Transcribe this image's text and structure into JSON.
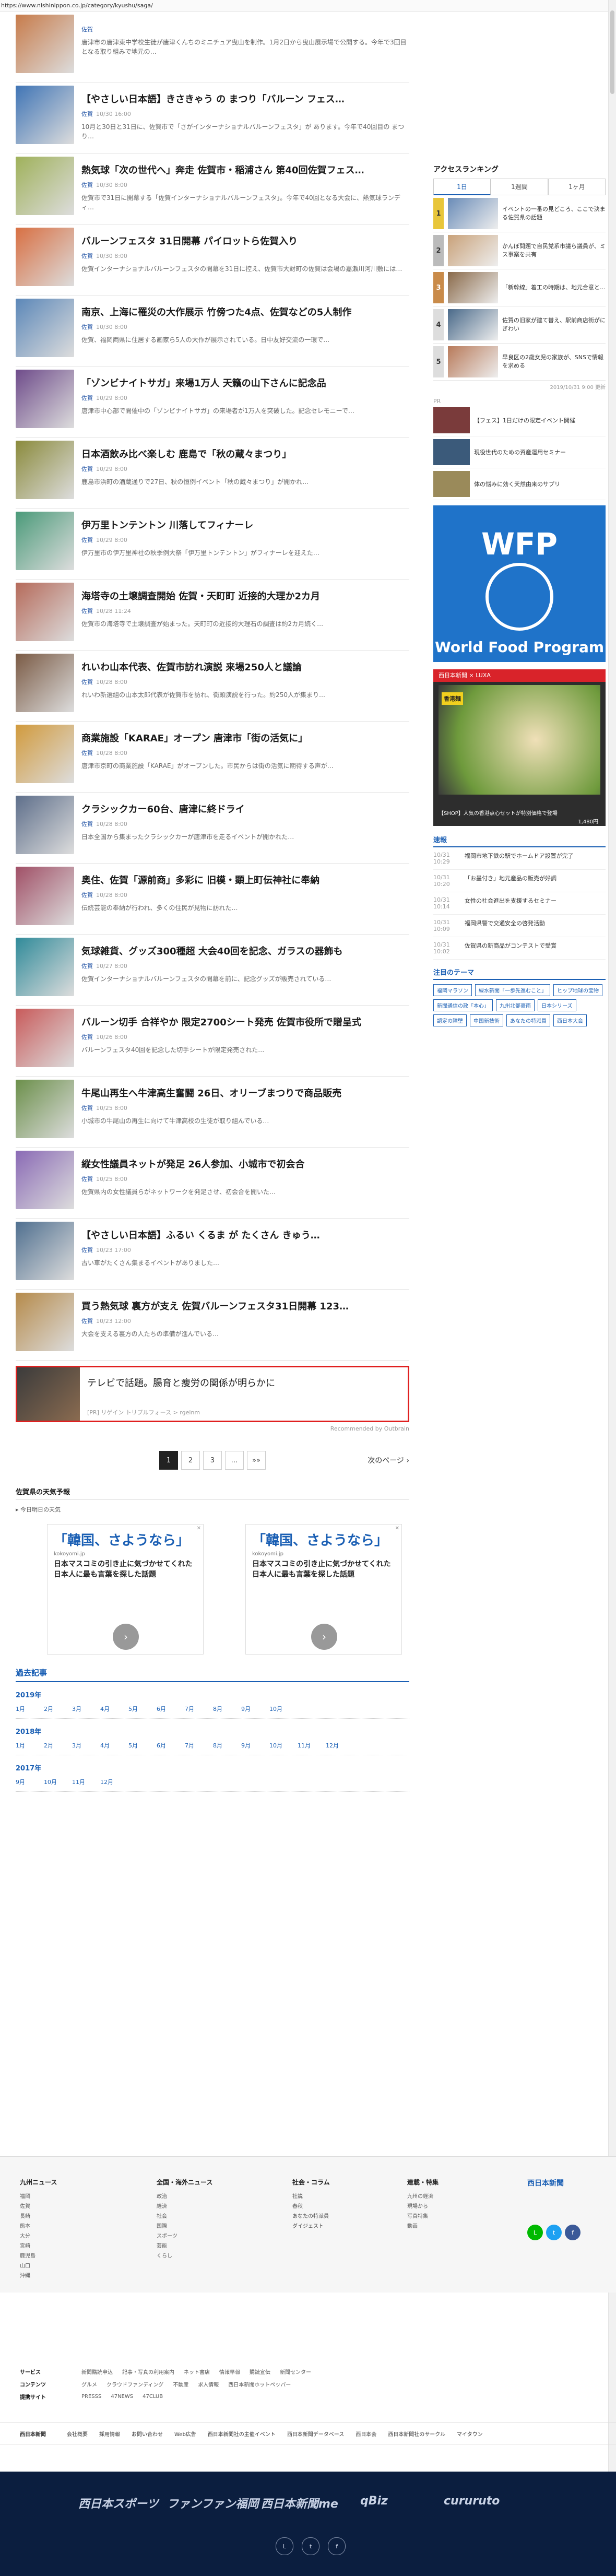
{
  "url": "https://www.nishinippon.co.jp/category/kyushu/saga/",
  "articles": [
    {
      "title": "",
      "tag": "佐賀",
      "time": "",
      "lead": "唐津市の唐津東中学校生徒が唐津くんちのミニチュア曳山を制作。1月2日から曳山展示場で公開する。今年で3回目となる取り組みで地元の…"
    },
    {
      "title": "【やさしい日本語】きさきゃう の まつり「バルーン フェス…",
      "tag": "佐賀",
      "time": "10/30 16:00",
      "lead": "10月と30日と31日に、佐賀市で「さがインターナショナルバルーンフェスタ」が あります。今年で40回目の まつり…"
    },
    {
      "title": "熱気球「次の世代へ」奔走 佐賀市・稲浦さん 第40回佐賀フェス…",
      "tag": "佐賀",
      "time": "10/30 8:00",
      "lead": "佐賀市で31日に開幕する「佐賀インターナショナルバルーンフェスタ」。今年で40回となる大会に、熱気球ランディ…"
    },
    {
      "title": "バルーンフェスタ 31日開幕 パイロットら佐賀入り",
      "tag": "佐賀",
      "time": "10/30 8:00",
      "lead": "佐賀インターナショナルバルーンフェスタの開幕を31日に控え、佐賀市大財町の佐賀は会場の嘉瀬川河川敷には…"
    },
    {
      "title": "南京、上海に罹災の大作展示 竹傍つた4点、佐賀などの5人制作",
      "tag": "佐賀",
      "time": "10/30 8:00",
      "lead": "佐賀、福岡両県に住居する画家ら5人の大作が展示されている。日中友好交流の一環で…"
    },
    {
      "title": "「ゾンビナイトサガ」来場1万人 天籟の山下さんに記念品",
      "tag": "佐賀",
      "time": "10/29 8:00",
      "lead": "唐津市中心部で開催中の「ゾンビナイトサガ」の来場者が1万人を突破した。記念セレモニーで…"
    },
    {
      "title": "日本酒飲み比べ楽しむ 鹿島で「秋の蔵々まつり」",
      "tag": "佐賀",
      "time": "10/29 8:00",
      "lead": "鹿島市浜町の酒蔵通りで27日、秋の恒例イベント「秋の蔵々まつり」が開かれ…"
    },
    {
      "title": "伊万里トンテントン 川落してフィナーレ",
      "tag": "佐賀",
      "time": "10/29 8:00",
      "lead": "伊万里市の伊万里神社の秋季例大祭「伊万里トンテントン」がフィナーレを迎えた…"
    },
    {
      "title": "海塔寺の土壌調査開始 佐賀・天町町 近接的大理か2カ月",
      "tag": "佐賀",
      "time": "10/28 11:24",
      "lead": "佐賀市の海塔寺で土壌調査が始まった。天町町の近接的大理石の調査は約2カ月続く…"
    },
    {
      "title": "れいわ山本代表、佐賀市訪れ演説 来場250人と議論",
      "tag": "佐賀",
      "time": "10/28 8:00",
      "lead": "れいわ新選組の山本太郎代表が佐賀市を訪れ、街頭演説を行った。約250人が集まり…"
    },
    {
      "title": "商業施設「KARAE」オープン 唐津市「街の活気に」",
      "tag": "佐賀",
      "time": "10/28 8:00",
      "lead": "唐津市京町の商業施設「KARAE」がオープンした。市民からは街の活気に期待する声が…"
    },
    {
      "title": "クラシックカー60台、唐津に終ドライ",
      "tag": "佐賀",
      "time": "10/28 8:00",
      "lead": "日本全国から集まったクラシックカーが唐津市を走るイベントが開かれた…"
    },
    {
      "title": "奥住、佐賀「源前商」多彩に 旧模・顕上町伝神社に奉納",
      "tag": "佐賀",
      "time": "10/28 8:00",
      "lead": "伝統芸能の奉納が行われ、多くの住民が見物に訪れた…"
    },
    {
      "title": "気球雑貨、グッズ300種超 大会40回を記念、ガラスの器飾も",
      "tag": "佐賀",
      "time": "10/27 8:00",
      "lead": "佐賀インターナショナルバルーンフェスタの開幕を前に、記念グッズが販売されている…"
    },
    {
      "title": "バルーン切手 合祥やか 限定2700シート発売 佐賀市役所で贈呈式",
      "tag": "佐賀",
      "time": "10/26 8:00",
      "lead": "バルーンフェスタ40回を記念した切手シートが限定発売された…"
    },
    {
      "title": "牛尾山再生へ牛津高生奮闘 26日、オリーブまつりで商品販売",
      "tag": "佐賀",
      "time": "10/25 8:00",
      "lead": "小城市の牛尾山の再生に向けて牛津高校の生徒が取り組んでいる…"
    },
    {
      "title": "縦女性議員ネットが発足 26人参加、小城市で初会合",
      "tag": "佐賀",
      "time": "10/25 8:00",
      "lead": "佐賀県内の女性議員らがネットワークを発足させ、初会合を開いた…"
    },
    {
      "title": "【やさしい日本語】ふるい くるま が たくさん きゅう…",
      "tag": "佐賀",
      "time": "10/23 17:00",
      "lead": "古い車がたくさん集まるイベントがありました…"
    },
    {
      "title": "買う熱気球 裏方が支え 佐賀バルーンフェスタ31日開幕 123…",
      "tag": "佐賀",
      "time": "10/23 12:00",
      "lead": "大会を支える裏方の人たちの準備が進んでいる…"
    }
  ],
  "promo": {
    "title": "テレビで話題。腸育と痩労の関係が明らかに",
    "meta": "[PR] リゲイン トリプルフォース > rgeinm"
  },
  "recommended": "Recommended by Outbrain",
  "pagination": {
    "pages": [
      "1",
      "2",
      "3",
      "…",
      "»»"
    ],
    "next": "次のページ"
  },
  "popular": {
    "title": "佐賀県の天気予報",
    "note": "今日明日の天気"
  },
  "ads": [
    {
      "title": "「韓国、さようなら」",
      "domain": "kokoyomi.jp",
      "text": "日本マスコミの引き止に気づかせてくれた日本人に最も言葉を探した話題"
    },
    {
      "title": "「韓国、さようなら」",
      "domain": "kokoyomi.jp",
      "text": "日本マスコミの引き止に気づかせてくれた日本人に最も言葉を探した話題"
    }
  ],
  "archive": {
    "title": "過去記事",
    "years": [
      {
        "year": "2019年",
        "months": [
          "1月",
          "2月",
          "3月",
          "4月",
          "5月",
          "6月",
          "7月",
          "8月",
          "9月",
          "10月"
        ]
      },
      {
        "year": "2018年",
        "months": [
          "1月",
          "2月",
          "3月",
          "4月",
          "5月",
          "6月",
          "7月",
          "8月",
          "9月",
          "10月",
          "11月",
          "12月"
        ]
      },
      {
        "year": "2017年",
        "months": [
          "9月",
          "10月",
          "11月",
          "12月"
        ]
      }
    ]
  },
  "sidebar": {
    "ranking_title": "アクセスランキング",
    "tabs": [
      "1日",
      "1週間",
      "1ヶ月"
    ],
    "ranks": [
      {
        "n": "1",
        "t": "イベントの一番の見どころ、ここで決まる佐賀県の話題"
      },
      {
        "n": "2",
        "t": "かんぽ問題で自民党系市議ら議員が、ミス事案を共有"
      },
      {
        "n": "3",
        "t": "「新幹線」着工の時期は、地元合意と…"
      },
      {
        "n": "4",
        "t": "佐賀の旧家が建て替え、駅前商店街がにぎわい"
      },
      {
        "n": "5",
        "t": "早良区の2歳女児の家族が、SNSで情報を求める"
      }
    ],
    "stamp": "2019/10/31 9:00 更新",
    "pr_title": "PR",
    "prs": [
      {
        "t": "【フェス】1日だけの限定イベント開催"
      },
      {
        "t": "現役世代のための資産運用セミナー"
      },
      {
        "t": "体の悩みに効く天然由来のサプリ"
      }
    ],
    "wfp_jp": "WFP",
    "wfp_name": "World Food Program",
    "luxa_top": "西日本新聞 × LUXA",
    "luxa_badge": "香港麺",
    "luxa_cap": "【SHOP】人気の香港点心セットが特別価格で登場",
    "luxa_price": "1,480円",
    "news_title": "速報",
    "news": [
      {
        "tm": "10/31 10:29",
        "t": "福岡市地下鉄の駅でホームドア設置が完了"
      },
      {
        "tm": "10/31 10:20",
        "t": "「お墨付き」地元産品の販売が好調"
      },
      {
        "tm": "10/31 10:14",
        "t": "女性の社会進出を支援するセミナー"
      },
      {
        "tm": "10/31 10:09",
        "t": "福岡県警で交通安全の啓発活動"
      },
      {
        "tm": "10/31 10:02",
        "t": "佐賀県の新商品がコンテストで受賞"
      }
    ],
    "theme_title": "注目のテーマ",
    "themes": [
      "福岡マラソン",
      "緑水新聞「一歩先進むこと」",
      "ヒップ地球の宝物",
      "新聞通信の政「本心」",
      "九州北部豪雨",
      "日本シリーズ",
      "認定の障壁",
      "中国新技術",
      "あなたの特派員",
      "西日本大会"
    ]
  },
  "footer": {
    "cols": [
      {
        "h": "九州ニュース",
        "items": [
          "福岡",
          "佐賀",
          "長崎",
          "熊本",
          "大分",
          "宮崎",
          "鹿児島",
          "山口",
          "沖縄"
        ]
      },
      {
        "h": "全国・海外ニュース",
        "items": [
          "政治",
          "経済",
          "社会",
          "国際",
          "スポーツ",
          "芸能",
          "くらし"
        ]
      },
      {
        "h": "社会・コラム",
        "items": [
          "社説",
          "春秋",
          "あなたの特派員",
          "ダイジェスト"
        ]
      },
      {
        "h": "連載・特集",
        "items": [
          "九州の経済",
          "現場から",
          "写真特集",
          "動画"
        ]
      }
    ],
    "logo": "西日本新聞",
    "rows": [
      {
        "h": "サービス",
        "items": [
          "新聞購読申込",
          "記事・写真の利用案内",
          "ネット書店",
          "情報早報",
          "購読宣伝",
          "新聞センター"
        ]
      },
      {
        "h": "コンテンツ",
        "items": [
          "グルメ",
          "クラウドファンディング",
          "不動産",
          "求人情報",
          "西日本新聞ホットペッパー"
        ]
      },
      {
        "h": "提携サイト",
        "items": [
          "PRESSS",
          "47NEWS",
          "47CLUB"
        ]
      }
    ],
    "bar": [
      "会社概要",
      "採用情報",
      "お問い合わせ",
      "Web広告",
      "西日本新聞社の主催イベント",
      "西日本新聞データベース",
      "西日本会",
      "西日本新聞社のサークル",
      "マイタウン"
    ],
    "brands": [
      "西日本スポーツ",
      "ファンファン福岡",
      "西日本新聞me",
      "qBiz",
      "cururuto"
    ],
    "social": [
      "LINE",
      "Twitter",
      "Facebook"
    ],
    "copyright": "西日本新聞"
  }
}
